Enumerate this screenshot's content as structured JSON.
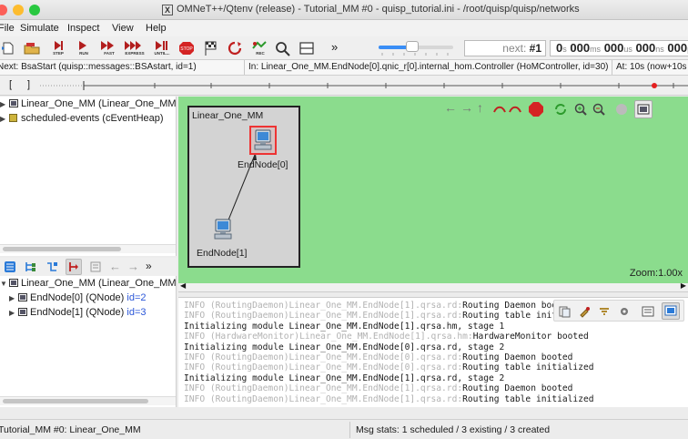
{
  "window": {
    "title": "OMNeT++/Qtenv (release) - Tutorial_MM #0 - quisp_tutorial.ini - /root/quisp/quisp/networks",
    "logo_glyph": "X",
    "lights": [
      "#fc5f57",
      "#fdbc2e",
      "#29c840"
    ]
  },
  "menu": {
    "items": [
      {
        "label": "File",
        "icon": "menu"
      },
      {
        "label": "Simulate"
      },
      {
        "label": "Inspect"
      },
      {
        "label": "View"
      },
      {
        "label": "Help"
      }
    ]
  },
  "toolbar": {
    "step_label": "STEP",
    "run_label": "RUN",
    "fast_label": "FAST",
    "express_label": "EXPRESS",
    "until_label": "UNTIL...",
    "stop_label": "STOP",
    "rec_label": "REC",
    "overflow_glyph": "»",
    "speed_fraction": 0.45,
    "next_label": "next:",
    "next_value": "#1",
    "time": {
      "s": "0",
      "ms": "000",
      "us": "000",
      "ns": "000",
      "ps_unit": "ps",
      "s_unit": "s",
      "ms_unit": "ms",
      "us_unit": "us",
      "ns_unit": "ns"
    }
  },
  "infobar": {
    "next_event": "Next: BsaStart (quisp::messages::BSAstart, id=1)",
    "in_module": "In: Linear_One_MM.EndNode[0].qnic_r[0].internal_hom.Controller (HoMController, id=30)",
    "at_time": "At: 10s (now+10s"
  },
  "timeline": {
    "bracket_left": "[",
    "bracket_right": "]"
  },
  "object_tree": {
    "items": [
      {
        "label": "Linear_One_MM (Linear_One_MM",
        "type": "network"
      },
      {
        "label": "scheduled-events (cEventHeap)",
        "type": "heap"
      }
    ]
  },
  "module_tree": {
    "overflow_glyph": "»",
    "root": "Linear_One_MM (Linear_One_MM",
    "children": [
      {
        "label": "EndNode[0] (QNode)",
        "id": "id=2"
      },
      {
        "label": "EndNode[1] (QNode)",
        "id": "id=3"
      }
    ]
  },
  "canvas": {
    "network_name": "Linear_One_MM",
    "nodes": [
      {
        "name": "EndNode[0]",
        "selected": true
      },
      {
        "name": "EndNode[1]",
        "selected": false
      }
    ],
    "zoom": "Zoom:1.00x",
    "background": "#8bdc8d"
  },
  "log": {
    "lines": [
      {
        "prefix": "INFO (RoutingDaemon)Linear_One_MM.EndNode[1].qrsa.rd:",
        "text": "Routing Daemon booted",
        "dim": false
      },
      {
        "prefix": "INFO (RoutingDaemon)Linear_One_MM.EndNode[1].qrsa.rd:",
        "text": "Routing table initi",
        "dim": false
      },
      {
        "prefix": "",
        "text": "Initializing module Linear_One_MM.EndNode[1].qrsa.hm, stage 1",
        "dim": false
      },
      {
        "prefix": "INFO (HardwareMonitor)Linear_One_MM.EndNode[1].qrsa.hm:",
        "text": "HardwareMonitor booted",
        "dim": false
      },
      {
        "prefix": "",
        "text": "Initializing module Linear_One_MM.EndNode[0].qrsa.rd, stage 2",
        "dim": false
      },
      {
        "prefix": "INFO (RoutingDaemon)Linear_One_MM.EndNode[0].qrsa.rd:",
        "text": "Routing Daemon booted",
        "dim": false
      },
      {
        "prefix": "INFO (RoutingDaemon)Linear_One_MM.EndNode[0].qrsa.rd:",
        "text": "Routing table initialized",
        "dim": false
      },
      {
        "prefix": "",
        "text": "Initializing module Linear_One_MM.EndNode[1].qrsa.rd, stage 2",
        "dim": false
      },
      {
        "prefix": "INFO (RoutingDaemon)Linear_One_MM.EndNode[1].qrsa.rd:",
        "text": "Routing Daemon booted",
        "dim": false
      },
      {
        "prefix": "INFO (RoutingDaemon)Linear_One_MM.EndNode[1].qrsa.rd:",
        "text": "Routing table initialized",
        "dim": false
      }
    ]
  },
  "status": {
    "left": "Tutorial_MM #0: Linear_One_MM",
    "right": "Msg stats: 1 scheduled / 3 existing / 3 created"
  }
}
